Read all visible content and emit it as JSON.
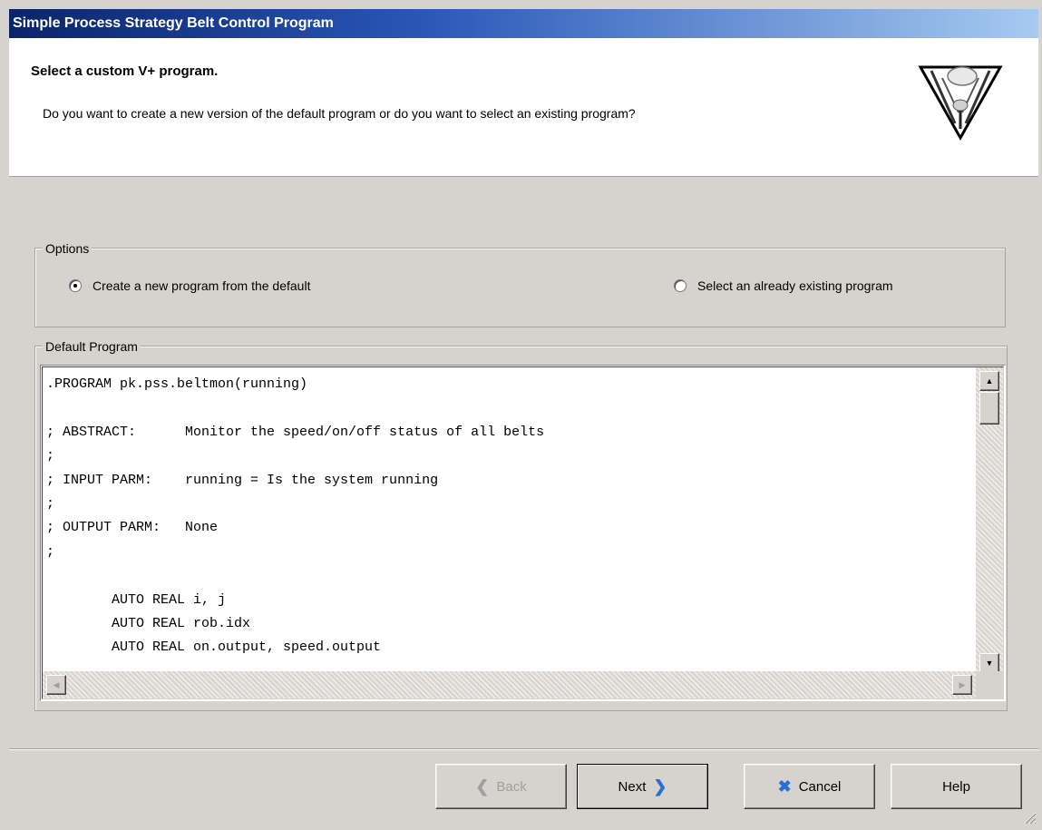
{
  "window": {
    "title": "Simple Process Strategy Belt Control Program"
  },
  "header": {
    "title": "Select a custom V+ program.",
    "description": "Do you want to create a new version of the default program or do you want to select an existing program?",
    "icon": "delta-robot-icon"
  },
  "options": {
    "legend": "Options",
    "choices": [
      {
        "label": "Create a new program from the default",
        "selected": true
      },
      {
        "label": "Select an already existing program",
        "selected": false
      }
    ]
  },
  "default_program": {
    "legend": "Default Program",
    "lines": [
      ".PROGRAM pk.pss.beltmon(running)",
      "",
      "; ABSTRACT:      Monitor the speed/on/off status of all belts",
      ";",
      "; INPUT PARM:    running = Is the system running",
      ";",
      "; OUTPUT PARM:   None",
      ";",
      "",
      "        AUTO REAL i, j",
      "        AUTO REAL rob.idx",
      "        AUTO REAL on.output, speed.output"
    ]
  },
  "buttons": {
    "back": {
      "label": "Back",
      "enabled": false,
      "icon": "back-arrow-icon"
    },
    "next": {
      "label": "Next",
      "enabled": true,
      "icon": "next-arrow-icon"
    },
    "cancel": {
      "label": "Cancel",
      "enabled": true,
      "icon": "cancel-x-icon"
    },
    "help": {
      "label": "Help",
      "enabled": true
    }
  }
}
